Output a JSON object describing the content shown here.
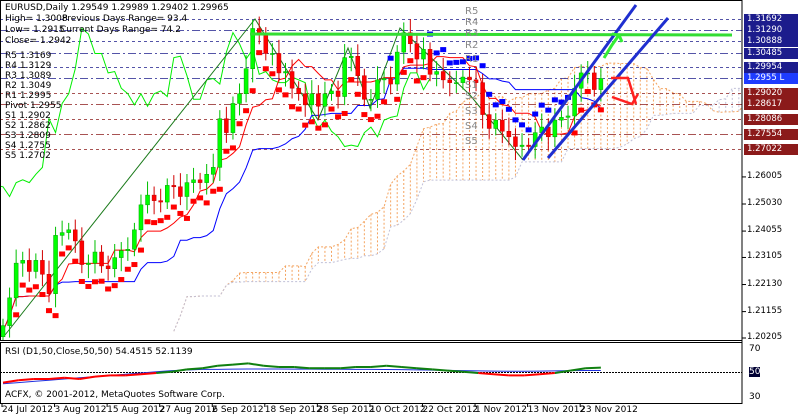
{
  "header": {
    "symbol_line": "EURUSD,Daily  1.29549 1.29989 1.29402 1.29965",
    "high": "High= 1.3008",
    "prev_range": "Previous Days Range= 93.4",
    "low": "Low= 1.2915",
    "cur_range": "Current Days Range= 74.2",
    "close": "Close= 1.2942"
  },
  "pivots": [
    {
      "label": "R5 1.3169",
      "tag": "R5"
    },
    {
      "label": "R4 1.3129",
      "tag": "R4"
    },
    {
      "label": "R3 1.3089",
      "tag": "R3"
    },
    {
      "label": "R2 1.3049",
      "tag": "R2"
    },
    {
      "label": "R1 1.2995",
      "tag": "R1"
    },
    {
      "label": "Pivot 1.2955",
      "tag": ""
    },
    {
      "label": "S1 1.2902",
      "tag": "S1"
    },
    {
      "label": "S2 1.2862",
      "tag": "S2"
    },
    {
      "label": "S3 1.2809",
      "tag": "S3"
    },
    {
      "label": "S4 1.2755",
      "tag": "S4"
    },
    {
      "label": "S5 1.2702",
      "tag": "S5"
    }
  ],
  "price_labels": [
    {
      "text": "1.31692",
      "price": 1.31692,
      "color": "#1c1c8c"
    },
    {
      "text": "1.31290",
      "price": 1.3129,
      "color": "#1c1c8c"
    },
    {
      "text": "1.30888",
      "price": 1.30888,
      "color": "#1c1c8c"
    },
    {
      "text": "1.30485",
      "price": 1.30485,
      "color": "#1c1c8c"
    },
    {
      "text": "1.29954",
      "price": 1.29954,
      "color": "#1c1c8c"
    },
    {
      "text": "1.2955 L",
      "price": 1.2955,
      "color": "#1e3cff"
    },
    {
      "text": "1.29020",
      "price": 1.2902,
      "color": "#8b1a1a"
    },
    {
      "text": "1.28617",
      "price": 1.28617,
      "color": "#8b1a1a"
    },
    {
      "text": "1.28086",
      "price": 1.28086,
      "color": "#8b1a1a"
    },
    {
      "text": "1.27554",
      "price": 1.27554,
      "color": "#8b1a1a"
    },
    {
      "text": "1.27022",
      "price": 1.27022,
      "color": "#8b1a1a"
    }
  ],
  "price_ticks": [
    "1.26005",
    "1.25030",
    "1.24055",
    "1.23105",
    "1.22130",
    "1.21155",
    "1.20205"
  ],
  "price_tick_values": [
    1.26005,
    1.2503,
    1.24055,
    1.23105,
    1.2213,
    1.21155,
    1.20205
  ],
  "dates": [
    "24 Jul 2012",
    "3 Aug 2012",
    "15 Aug 2012",
    "27 Aug 2012",
    "6 Sep 2012",
    "18 Sep 2012",
    "28 Sep 2012",
    "10 Oct 2012",
    "22 Oct 2012",
    "1 Nov 2012",
    "13 Nov 2012",
    "23 Nov 2012"
  ],
  "closes": [
    1.2065,
    1.2165,
    1.229,
    1.23,
    1.226,
    1.23,
    1.225,
    1.218,
    1.239,
    1.24,
    1.241,
    1.237,
    1.2285,
    1.229,
    1.233,
    1.228,
    1.227,
    1.231,
    1.2335,
    1.234,
    1.241,
    1.25,
    1.2535,
    1.2515,
    1.251,
    1.257,
    1.2565,
    1.253,
    1.258,
    1.259,
    1.258,
    1.261,
    1.2635,
    1.281,
    1.276,
    1.2865,
    1.29,
    1.299,
    1.3135,
    1.3115,
    1.3045,
    1.3045,
    1.2975,
    1.298,
    1.292,
    1.29,
    1.286,
    1.29,
    1.2855,
    1.29,
    1.291,
    1.289,
    1.303,
    1.3035,
    1.2965,
    1.288,
    1.288,
    1.295,
    1.2955,
    1.2935,
    1.305,
    1.312,
    1.308,
    1.3025,
    1.306,
    1.297,
    1.298,
    1.295,
    1.294,
    1.294,
    1.296,
    1.295,
    1.294,
    1.2825,
    1.2775,
    1.2805,
    1.2765,
    1.2745,
    1.271,
    1.2715,
    1.271,
    1.276,
    1.278,
    1.2745,
    1.2805,
    1.2815,
    1.282,
    1.292,
    1.2975,
    1.2975,
    1.2915,
    1.2955
  ],
  "rsi": {
    "title": "RSI (D1,50,Close,50,50) 54.4515 52.1139",
    "levels": [
      "70",
      "50",
      "30"
    ],
    "values": [
      42,
      44,
      45,
      45,
      46,
      45,
      47,
      48,
      48,
      49,
      50,
      51,
      53,
      54,
      56,
      57,
      58,
      56,
      55,
      55,
      54,
      54,
      54,
      55,
      55,
      56,
      55,
      54,
      53,
      52,
      51,
      50,
      49,
      48,
      48,
      49,
      50,
      52,
      54,
      54.45
    ],
    "signal": [
      41,
      42,
      43,
      44,
      45,
      46,
      47,
      48,
      49,
      50,
      51,
      52,
      52.5,
      53,
      53,
      53.2,
      53.3,
      53.3,
      53.3,
      53.2,
      53.2,
      53.1,
      53.1,
      53,
      53,
      52.9,
      52.8,
      52.6,
      52.4,
      52.2,
      52,
      51.8,
      51.6,
      51.5,
      51.5,
      51.6,
      51.8,
      52,
      52.1,
      52.11
    ]
  },
  "copyright": "ACFX, © 2001-2012, MetaQuotes Software Corp.",
  "colors": {
    "bull": "#00ff00",
    "bear": "#ff0000",
    "tenkan": "#ff0000",
    "kijun": "#0000ff",
    "chikou": "#00ee00",
    "cloud_a": "#f4a460",
    "cloud_b": "#c0c0d8",
    "pivot_r": "#1c1c8c",
    "pivot_s": "#8b1a1a"
  }
}
